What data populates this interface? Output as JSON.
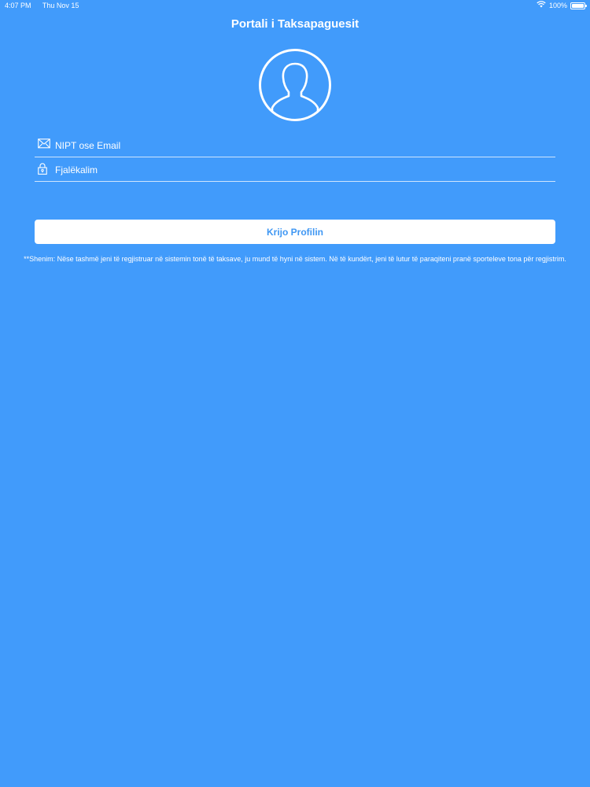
{
  "status_bar": {
    "time": "4:07 PM",
    "date": "Thu Nov 15",
    "battery": "100%",
    "battery_level": 1.0,
    "icons": [
      "wifi-icon",
      "battery-icon"
    ]
  },
  "header": {
    "title": "Portali i Taksapaguesit"
  },
  "avatar": {
    "icon": "user-silhouette-icon"
  },
  "form": {
    "email": {
      "placeholder": "NIPT ose Email",
      "icon": "envelope-icon"
    },
    "password": {
      "placeholder": "Fjalëkalim",
      "icon": "lock-icon"
    },
    "create_button_label": "Krijo Profilin"
  },
  "note": {
    "text": "**Shenim: Nëse tashmë jeni të regjistruar në sistemin tonë të taksave, ju mund të hyni në sistem. Në të kundërt, jeni të lutur të paraqiteni pranë sporteleve tona për regjistrim."
  },
  "colors": {
    "background": "#419bfb",
    "button_background": "#ffffff",
    "button_text": "#3f97f3",
    "text": "#ffffff"
  }
}
